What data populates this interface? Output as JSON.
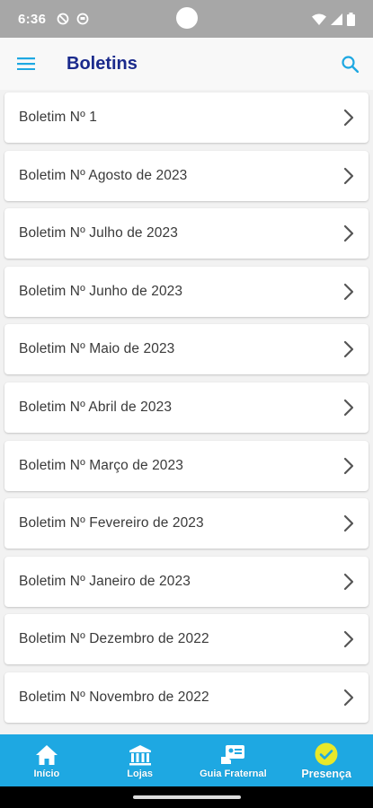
{
  "status_bar": {
    "time": "6:36"
  },
  "app_bar": {
    "title": "Boletins"
  },
  "boletins": [
    {
      "label": "Boletim Nº 1"
    },
    {
      "label": "Boletim Nº Agosto de 2023"
    },
    {
      "label": "Boletim Nº Julho de 2023"
    },
    {
      "label": "Boletim Nº Junho de 2023"
    },
    {
      "label": "Boletim Nº Maio de 2023"
    },
    {
      "label": "Boletim Nº Abril de 2023"
    },
    {
      "label": "Boletim Nº Março de 2023"
    },
    {
      "label": "Boletim Nº Fevereiro de 2023"
    },
    {
      "label": "Boletim Nº Janeiro de 2023"
    },
    {
      "label": "Boletim Nº Dezembro de 2022"
    },
    {
      "label": "Boletim Nº Novembro de 2022"
    }
  ],
  "bottom_nav": {
    "items": [
      {
        "label": "Início",
        "icon": "home-icon"
      },
      {
        "label": "Lojas",
        "icon": "building-icon"
      },
      {
        "label": "Guia Fraternal",
        "icon": "contact-card-icon"
      },
      {
        "label": "Presença",
        "icon": "check-circle-icon",
        "active": true
      }
    ]
  },
  "colors": {
    "status_bar": "#a7a7a7",
    "app_bar": "#f8f8f8",
    "title": "#1a2a8c",
    "accent": "#1ea8e2",
    "bottom_nav": "#1ea8e2",
    "active_icon": "#e8e82a"
  }
}
